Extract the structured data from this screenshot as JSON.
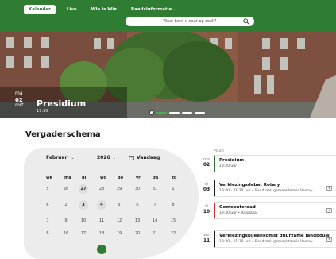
{
  "nav": {
    "items": [
      {
        "label": "Kalender",
        "active": true
      },
      {
        "label": "Live",
        "active": false
      },
      {
        "label": "Wie is Wie",
        "active": false
      },
      {
        "label": "Raadsinformatie",
        "active": false
      }
    ],
    "search_placeholder": "Waar bent u naar op zoek?"
  },
  "hero": {
    "day_name": "ma",
    "day_number": "02",
    "month": "mrt",
    "title": "Presidium",
    "time": "19:30"
  },
  "section_title": "Vergaderschema",
  "calendar": {
    "month": "Februari",
    "year": "2026",
    "today_label": "Vandaag",
    "headers": [
      "wk",
      "ma",
      "di",
      "wo",
      "do",
      "vr",
      "za",
      "zo"
    ],
    "rows": [
      [
        "5",
        "26",
        "27",
        "28",
        "29",
        "30",
        "31",
        "1"
      ],
      [
        "6",
        "2",
        "3",
        "4",
        "5",
        "6",
        "7",
        "8"
      ],
      [
        "7",
        "9",
        "10",
        "11",
        "12",
        "13",
        "14",
        "15"
      ],
      [
        "8",
        "16",
        "17",
        "18",
        "19",
        "20",
        "21",
        "22"
      ]
    ]
  },
  "events": {
    "month_label": "Maart",
    "items": [
      {
        "day": "ma",
        "date": "02",
        "title": "Presidium",
        "meta": "19:30 uur"
      },
      {
        "day": "di",
        "date": "03",
        "title": "Verkiezingsdebat Rotary",
        "meta": "19:30 - 21:30 uur  •  Raadzaal, gemeentehuis Venray"
      },
      {
        "day": "di",
        "date": "10",
        "title": "Gemeenteraad",
        "meta": "19:30 uur  •  Raadzaal"
      },
      {
        "day": "wo",
        "date": "11",
        "title": "Verkiezingsbijeenkomst duurzame landbouw",
        "meta": "19:30 - 21:30 uur  •  Raadzaal, gemeentehuis Venray"
      }
    ]
  },
  "colors": {
    "brand": "#2e7d32",
    "alert": "#d32f2f"
  }
}
